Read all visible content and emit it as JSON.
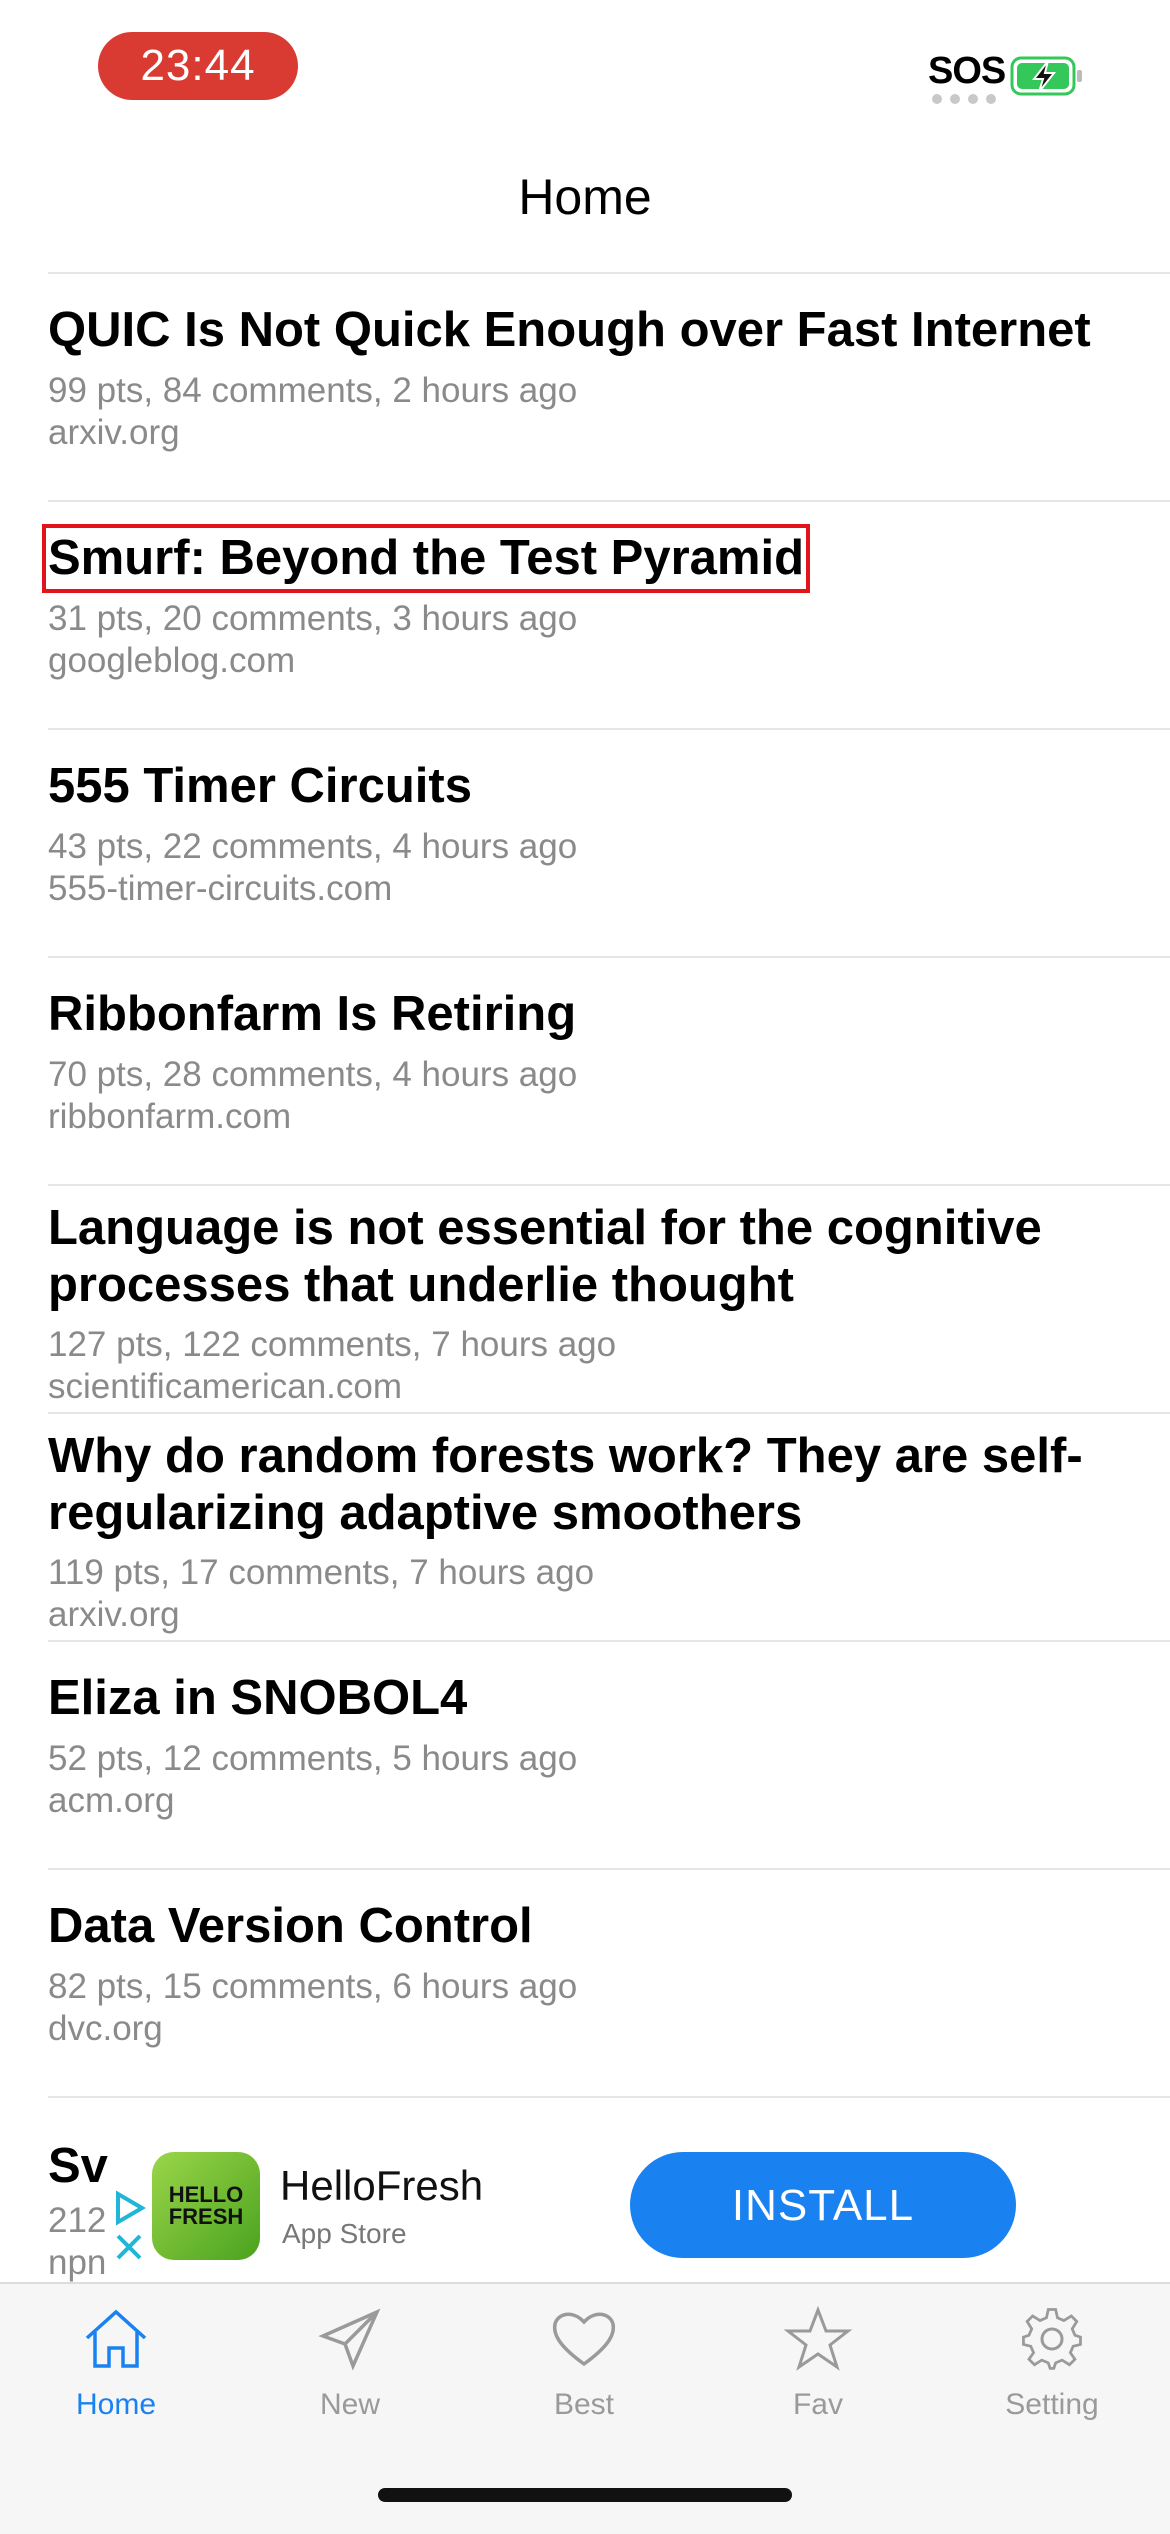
{
  "status": {
    "time": "23:44",
    "carrier": "SOS"
  },
  "nav": {
    "title": "Home"
  },
  "stories": [
    {
      "title": "QUIC Is Not Quick Enough over Fast Internet",
      "meta": "99 pts, 84 comments, 2 hours ago",
      "domain": "arxiv.org"
    },
    {
      "title": "Smurf: Beyond the Test Pyramid",
      "meta": "31 pts, 20 comments, 3 hours ago",
      "domain": "googleblog.com"
    },
    {
      "title": "555 Timer Circuits",
      "meta": "43 pts, 22 comments, 4 hours ago",
      "domain": "555-timer-circuits.com"
    },
    {
      "title": "Ribbonfarm Is Retiring",
      "meta": "70 pts, 28 comments, 4 hours ago",
      "domain": "ribbonfarm.com"
    },
    {
      "title": "Language is not essential for the cognitive processes that underlie thought",
      "meta": "127 pts, 122 comments, 7 hours ago",
      "domain": "scientificamerican.com"
    },
    {
      "title": "Why do random forests work? They are self-regularizing adaptive smoothers",
      "meta": "119 pts, 17 comments, 7 hours ago",
      "domain": "arxiv.org"
    },
    {
      "title": "Eliza in SNOBOL4",
      "meta": "52 pts, 12 comments, 5 hours ago",
      "domain": "acm.org"
    },
    {
      "title": "Data Version Control",
      "meta": "82 pts, 15 comments, 6 hours ago",
      "domain": "dvc.org"
    }
  ],
  "partial_story": {
    "title": "Sv",
    "meta": "212",
    "domain": "npn"
  },
  "ad": {
    "app_name": "HelloFresh",
    "store": "App Store",
    "icon_text": "HELLO FRESH",
    "cta": "INSTALL"
  },
  "tabs": [
    {
      "label": "Home",
      "icon": "house-icon",
      "active": true
    },
    {
      "label": "New",
      "icon": "paper-plane-icon",
      "active": false
    },
    {
      "label": "Best",
      "icon": "heart-icon",
      "active": false
    },
    {
      "label": "Fav",
      "icon": "star-icon",
      "active": false
    },
    {
      "label": "Setting",
      "icon": "gear-icon",
      "active": false
    }
  ],
  "colors": {
    "accent": "#1a82f0",
    "time_pill": "#d93a32",
    "highlight": "#e2131b",
    "battery": "#34c759"
  }
}
